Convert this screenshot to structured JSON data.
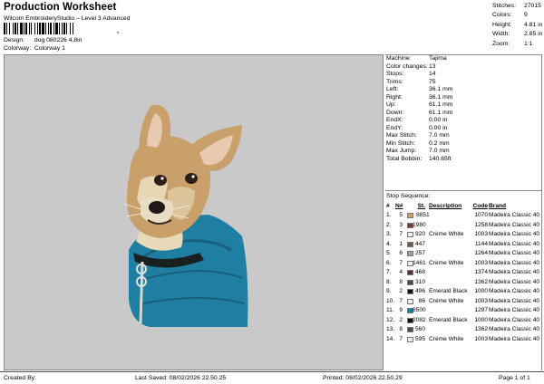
{
  "header": {
    "title": "Production Worksheet",
    "subtitle": "Wilcom EmbroideryStudio – Level 3 Advanced",
    "barcode_tail": ",",
    "design_label": "Design:",
    "design_value": "dog 080226 4,8in",
    "colorway_label": "Colorway:",
    "colorway_value": "Colorway 1"
  },
  "stats": [
    {
      "label": "Stitches:",
      "value": "27015"
    },
    {
      "label": "Colors:",
      "value": "9"
    },
    {
      "label": "Height:",
      "value": "4.81 in"
    },
    {
      "label": "Width:",
      "value": "2.85 in"
    },
    {
      "label": "Zoom:",
      "value": "1:1"
    }
  ],
  "machine_info": [
    {
      "label": "Machine:",
      "value": "Tajima"
    },
    {
      "label": "Color changes:",
      "value": "13"
    },
    {
      "label": "Stops:",
      "value": "14"
    },
    {
      "label": "Trims:",
      "value": "75"
    },
    {
      "label": "Left:",
      "value": "36.1 mm"
    },
    {
      "label": "Right:",
      "value": "36.1 mm"
    },
    {
      "label": "Up:",
      "value": "61.1 mm"
    },
    {
      "label": "Down:",
      "value": "61.1 mm"
    },
    {
      "label": "EndX:",
      "value": "0.00 in"
    },
    {
      "label": "EndY:",
      "value": "0.00 in"
    },
    {
      "label": "Max Stitch:",
      "value": "7.0 mm"
    },
    {
      "label": "Min Stitch:",
      "value": "0.2 mm"
    },
    {
      "label": "Max Jump:",
      "value": "7.0 mm"
    },
    {
      "label": "Total Bobbin:",
      "value": "140.65ft"
    }
  ],
  "sequence": {
    "title": "Stop Sequence:",
    "headers": {
      "hash": "#",
      "n": "N#",
      "st": "St.",
      "desc": "Description",
      "code": "Code",
      "brand": "Brand"
    },
    "rows": [
      {
        "idx": "1.",
        "n": "5",
        "color": "#c9a06a",
        "st": "8851",
        "desc": "",
        "code": "1070",
        "brand": "Madeira Classic 40"
      },
      {
        "idx": "2.",
        "n": "3",
        "color": "#7a3a2a",
        "st": "1980",
        "desc": "",
        "code": "1258",
        "brand": "Madeira Classic 40"
      },
      {
        "idx": "3.",
        "n": "7",
        "color": "#f2efe6",
        "st": "920",
        "desc": "Crème White",
        "code": "1003",
        "brand": "Madeira Classic 40"
      },
      {
        "idx": "4.",
        "n": "1",
        "color": "#6e5b4c",
        "st": "447",
        "desc": "",
        "code": "1144",
        "brand": "Madeira Classic 40"
      },
      {
        "idx": "5.",
        "n": "6",
        "color": "#a29aab",
        "st": "257",
        "desc": "",
        "code": "1264",
        "brand": "Madeira Classic 40"
      },
      {
        "idx": "6.",
        "n": "7",
        "color": "#f2efe6",
        "st": "1461",
        "desc": "Crème White",
        "code": "1003",
        "brand": "Madeira Classic 40"
      },
      {
        "idx": "7.",
        "n": "4",
        "color": "#5a2e2a",
        "st": "468",
        "desc": "",
        "code": "1374",
        "brand": "Madeira Classic 40"
      },
      {
        "idx": "8.",
        "n": "8",
        "color": "#4a4a4a",
        "st": "310",
        "desc": "",
        "code": "1362",
        "brand": "Madeira Classic 40"
      },
      {
        "idx": "9.",
        "n": "2",
        "color": "#0c1512",
        "st": "496",
        "desc": "Emerald Black",
        "code": "1000",
        "brand": "Madeira Classic 40"
      },
      {
        "idx": "10.",
        "n": "7",
        "color": "#f2efe6",
        "st": "86",
        "desc": "Crème White",
        "code": "1003",
        "brand": "Madeira Classic 40"
      },
      {
        "idx": "11.",
        "n": "9",
        "color": "#1f7fa3",
        "st": "8500",
        "desc": "",
        "code": "1297",
        "brand": "Madeira Classic 40"
      },
      {
        "idx": "12.",
        "n": "2",
        "color": "#0c1512",
        "st": "2082",
        "desc": "Emerald Black",
        "code": "1000",
        "brand": "Madeira Classic 40"
      },
      {
        "idx": "13.",
        "n": "8",
        "color": "#4a4a4a",
        "st": "560",
        "desc": "",
        "code": "1362",
        "brand": "Madeira Classic 40"
      },
      {
        "idx": "14.",
        "n": "7",
        "color": "#f2efe6",
        "st": "595",
        "desc": "Crème White",
        "code": "1003",
        "brand": "Madeira Classic 40"
      }
    ]
  },
  "footer": {
    "created_by": "Created By:",
    "last_saved": "Last Saved: 08/02/2026 22.50.25",
    "printed": "Printed: 08/02/2026 22.50.29",
    "page": "Page 1 of 1"
  },
  "colors": {
    "preview_bg": "#c9c9c9",
    "sweater": "#1f7fa3",
    "fur": "#c9a06a"
  }
}
